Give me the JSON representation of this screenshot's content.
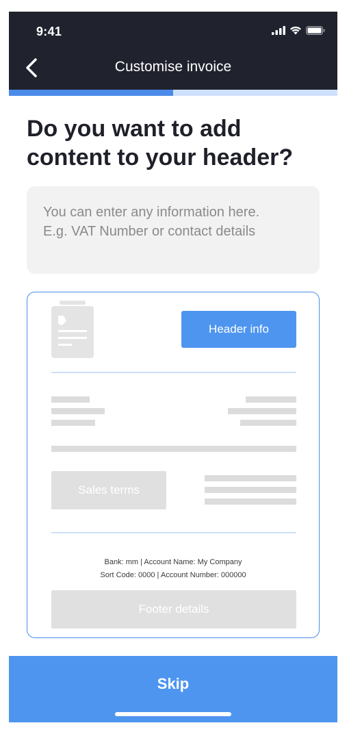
{
  "status_bar": {
    "time": "9:41",
    "icons": [
      "cellular-signal-icon",
      "wifi-icon",
      "battery-icon"
    ]
  },
  "nav": {
    "back_icon": "chevron-left-icon",
    "title": "Customise invoice"
  },
  "progress": {
    "fraction": 0.5
  },
  "question": {
    "line1": "Do you want to add",
    "line2": "content to your header?"
  },
  "info_input": {
    "placeholder_line1": "You can enter any information here.",
    "placeholder_line2": "E.g. VAT Number or contact details"
  },
  "preview": {
    "logo_icon": "invoice-logo-placeholder-icon",
    "header_info_label": "Header info",
    "sales_terms_label": "Sales terms",
    "bank_line1": "Bank: mm  |  Account Name: My Company",
    "bank_line2": "Sort Code: 0000  |  Account Number: 000000",
    "footer_details_label": "Footer details"
  },
  "skip": {
    "label": "Skip"
  },
  "colors": {
    "header_bg": "#20232e",
    "accent": "#4e95f0",
    "progress_track": "#cfe0fb",
    "placeholder_grey": "#dcdcdc"
  }
}
